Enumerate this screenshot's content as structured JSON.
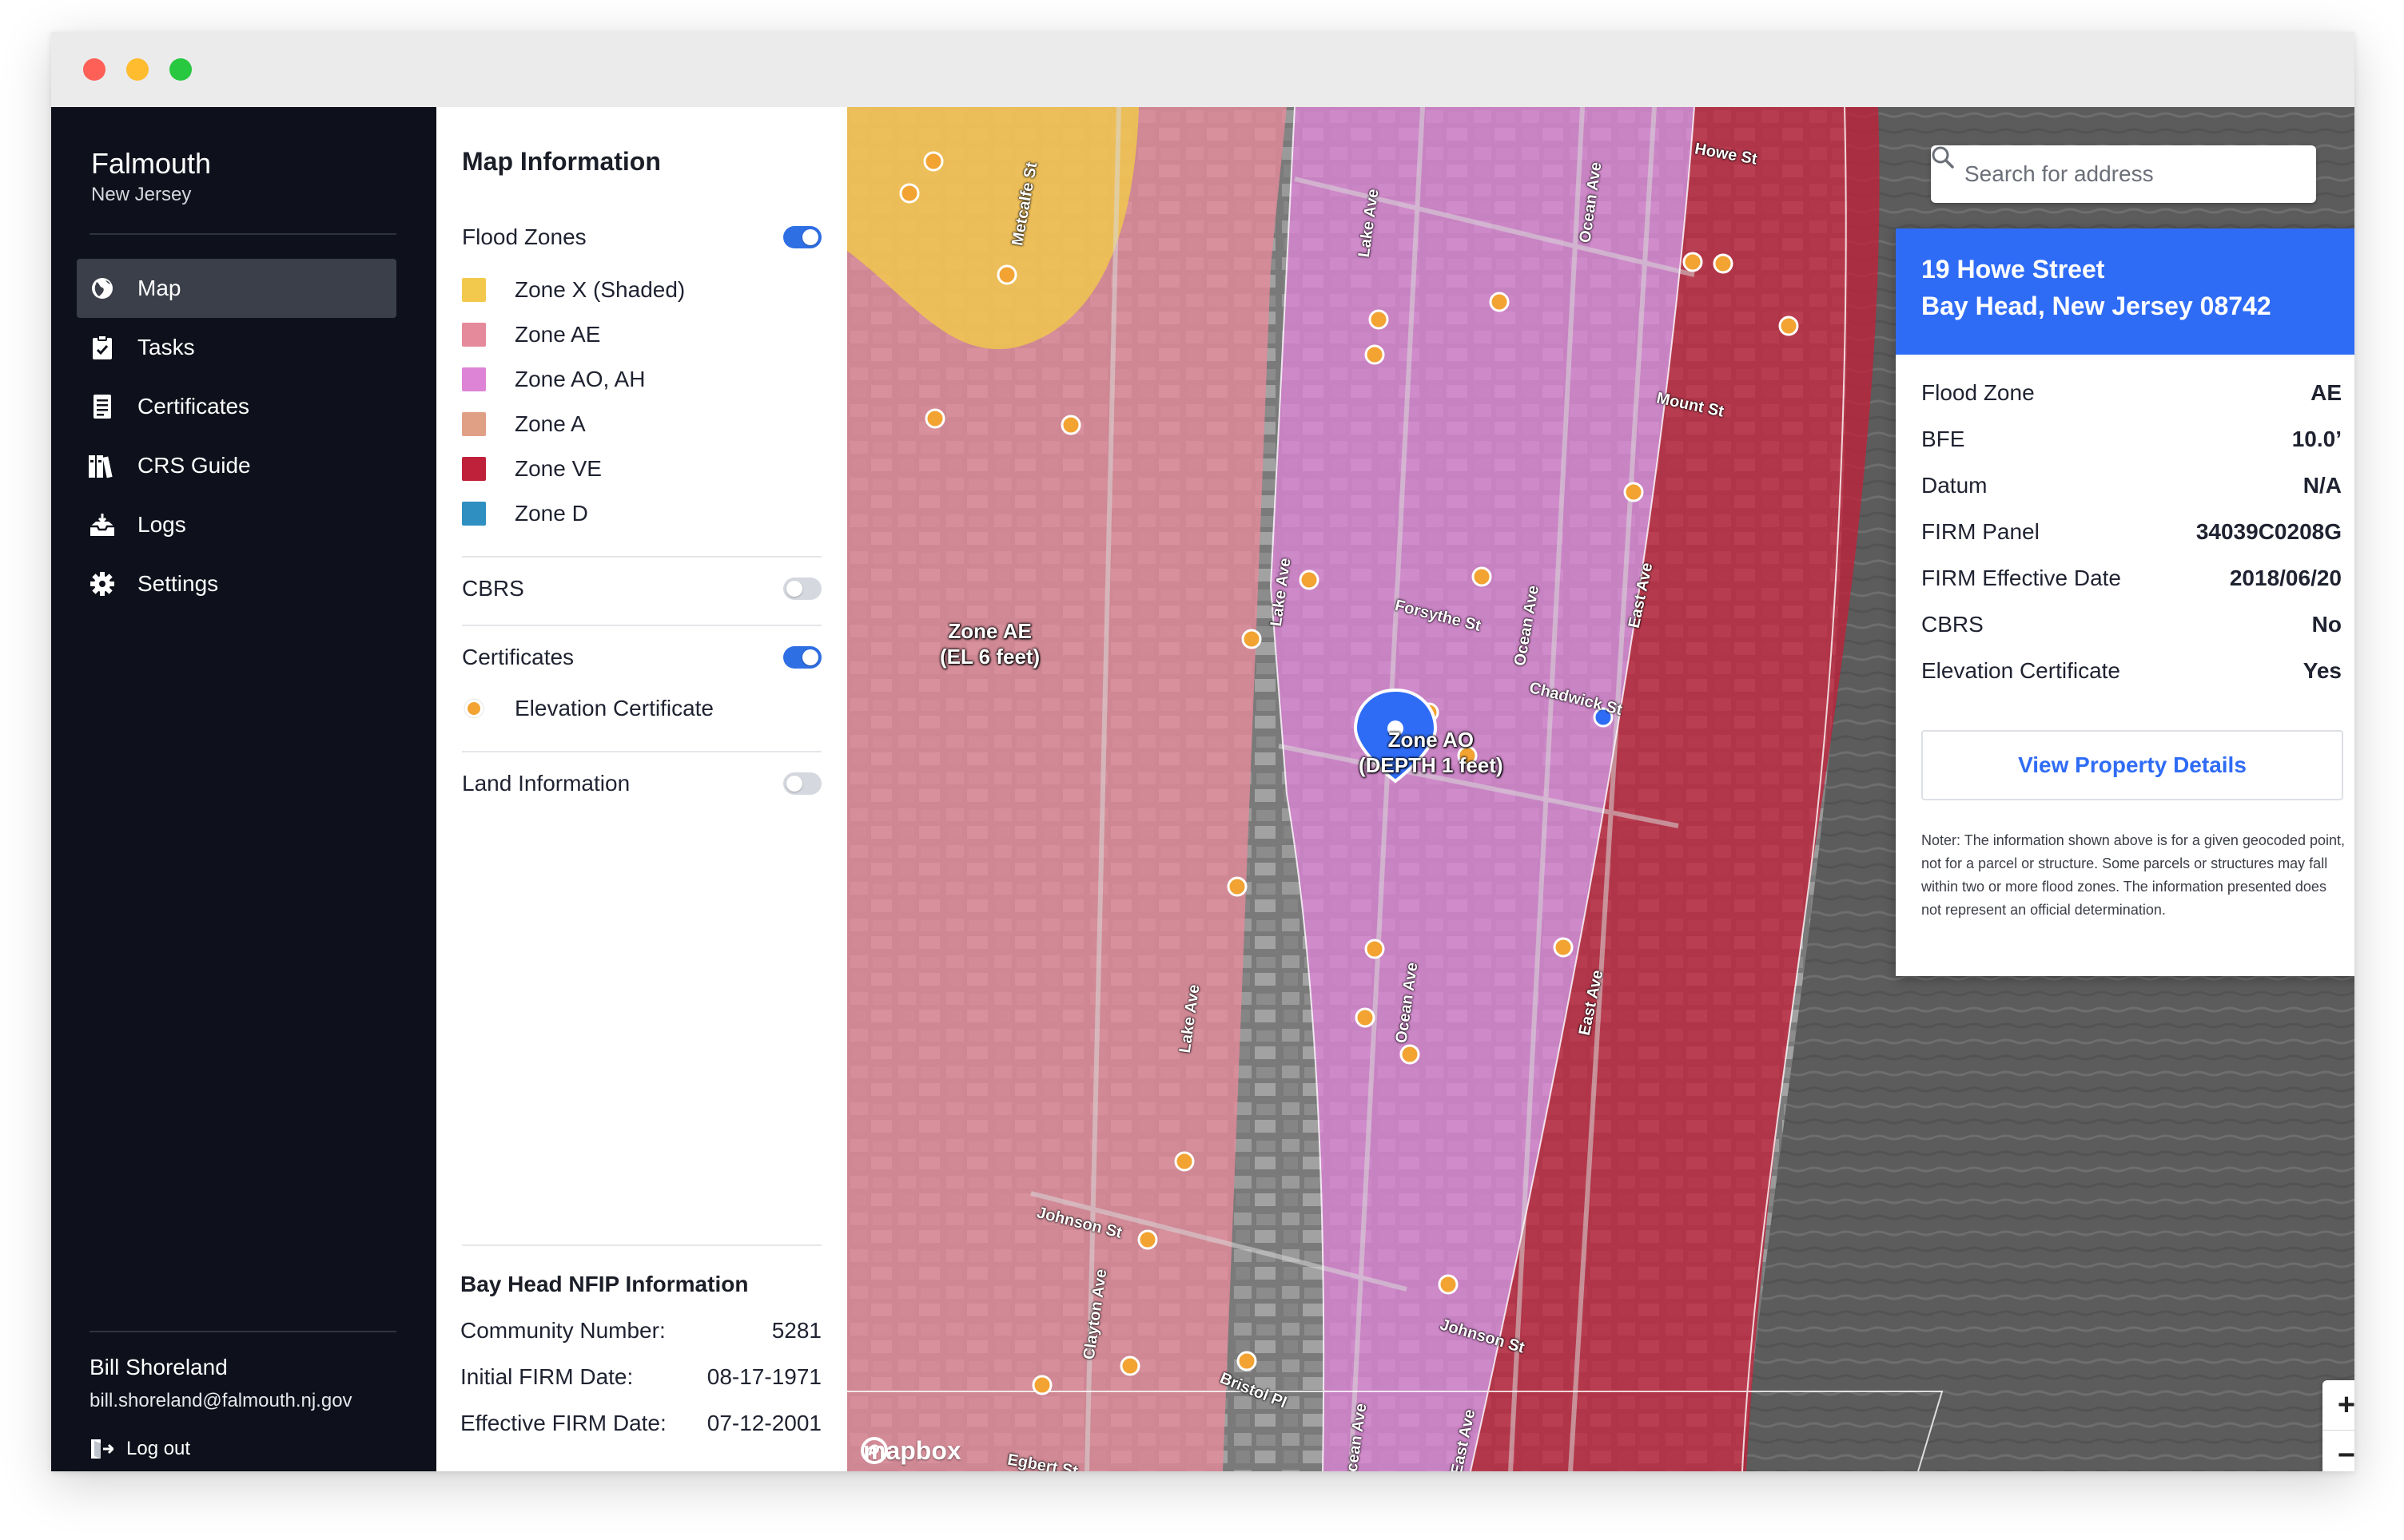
{
  "app": {
    "org_name": "Falmouth",
    "org_state": "New Jersey",
    "colors": {
      "sidebar_bg": "#0e111b",
      "accent": "#2f6cf6",
      "marker": "#f2a332"
    }
  },
  "window_controls": [
    "close",
    "minimize",
    "maximize"
  ],
  "nav": [
    {
      "label": "Map",
      "icon": "map-globe-icon",
      "active": true
    },
    {
      "label": "Tasks",
      "icon": "clipboard-icon",
      "active": false
    },
    {
      "label": "Certificates",
      "icon": "document-icon",
      "active": false
    },
    {
      "label": "CRS Guide",
      "icon": "books-icon",
      "active": false
    },
    {
      "label": "Logs",
      "icon": "inbox-tray-icon",
      "active": false
    },
    {
      "label": "Settings",
      "icon": "gear-icon",
      "active": false
    }
  ],
  "user": {
    "name": "Bill Shoreland",
    "email": "bill.shoreland@falmouth.nj.gov",
    "logout_label": "Log out"
  },
  "info_panel": {
    "title": "Map Information",
    "flood_zones": {
      "label": "Flood Zones",
      "enabled": true,
      "legend": [
        {
          "label": "Zone X (Shaded)",
          "color": "#f2c94c"
        },
        {
          "label": "Zone AE",
          "color": "#e58a9a"
        },
        {
          "label": "Zone AO, AH",
          "color": "#dd84d6"
        },
        {
          "label": "Zone A",
          "color": "#e0a085"
        },
        {
          "label": "Zone VE",
          "color": "#c0213a"
        },
        {
          "label": "Zone D",
          "color": "#2f8fc0"
        }
      ]
    },
    "cbrs": {
      "label": "CBRS",
      "enabled": false
    },
    "certificates": {
      "label": "Certificates",
      "enabled": true,
      "legend_label": "Elevation Certificate",
      "legend_color": "#f2a332"
    },
    "land_information": {
      "label": "Land Information",
      "enabled": false
    },
    "nfip": {
      "title": "Bay Head NFIP Information",
      "rows": [
        {
          "label": "Community Number:",
          "value": "5281"
        },
        {
          "label": "Initial FIRM Date:",
          "value": "08-17-1971"
        },
        {
          "label": "Effective FIRM Date:",
          "value": "07-12-2001"
        }
      ]
    }
  },
  "map": {
    "search_placeholder": "Search for address",
    "zone_labels": [
      {
        "line1": "Zone AE",
        "line2": "(EL 6 feet)"
      },
      {
        "line1": "Zone AO",
        "line2": "(DEPTH 1 feet)"
      }
    ],
    "streets": [
      "Metcalfe St",
      "Lake Ave",
      "Ocean Ave",
      "Howe St",
      "Mount St",
      "Forsythe St",
      "Ocean Ave",
      "East Ave",
      "Chadwick St",
      "Lake Ave",
      "Lake Ave",
      "Ocean Ave",
      "East Ave",
      "Johnson St",
      "Clayton Ave",
      "Bristol Pl",
      "Ocean Ave",
      "East Ave",
      "Johnson St",
      "Egbert St"
    ],
    "attribution": "mapbox",
    "zoom_in": "+",
    "zoom_out": "−"
  },
  "property": {
    "address_line1": "19 Howe Street",
    "address_line2": "Bay Head, New Jersey 08742",
    "rows": [
      {
        "label": "Flood Zone",
        "value": "AE"
      },
      {
        "label": "BFE",
        "value": "10.0’"
      },
      {
        "label": "Datum",
        "value": "N/A"
      },
      {
        "label": "FIRM Panel",
        "value": "34039C0208G"
      },
      {
        "label": "FIRM Effective Date",
        "value": "2018/06/20"
      },
      {
        "label": "CBRS",
        "value": "No"
      },
      {
        "label": "Elevation Certificate",
        "value": "Yes"
      }
    ],
    "button_label": "View Property Details",
    "note": "Noter: The information shown above is for a given geocoded point, not for a parcel or structure. Some parcels or structures may fall within two or more flood zones. The information presented does not represent an official determination."
  }
}
